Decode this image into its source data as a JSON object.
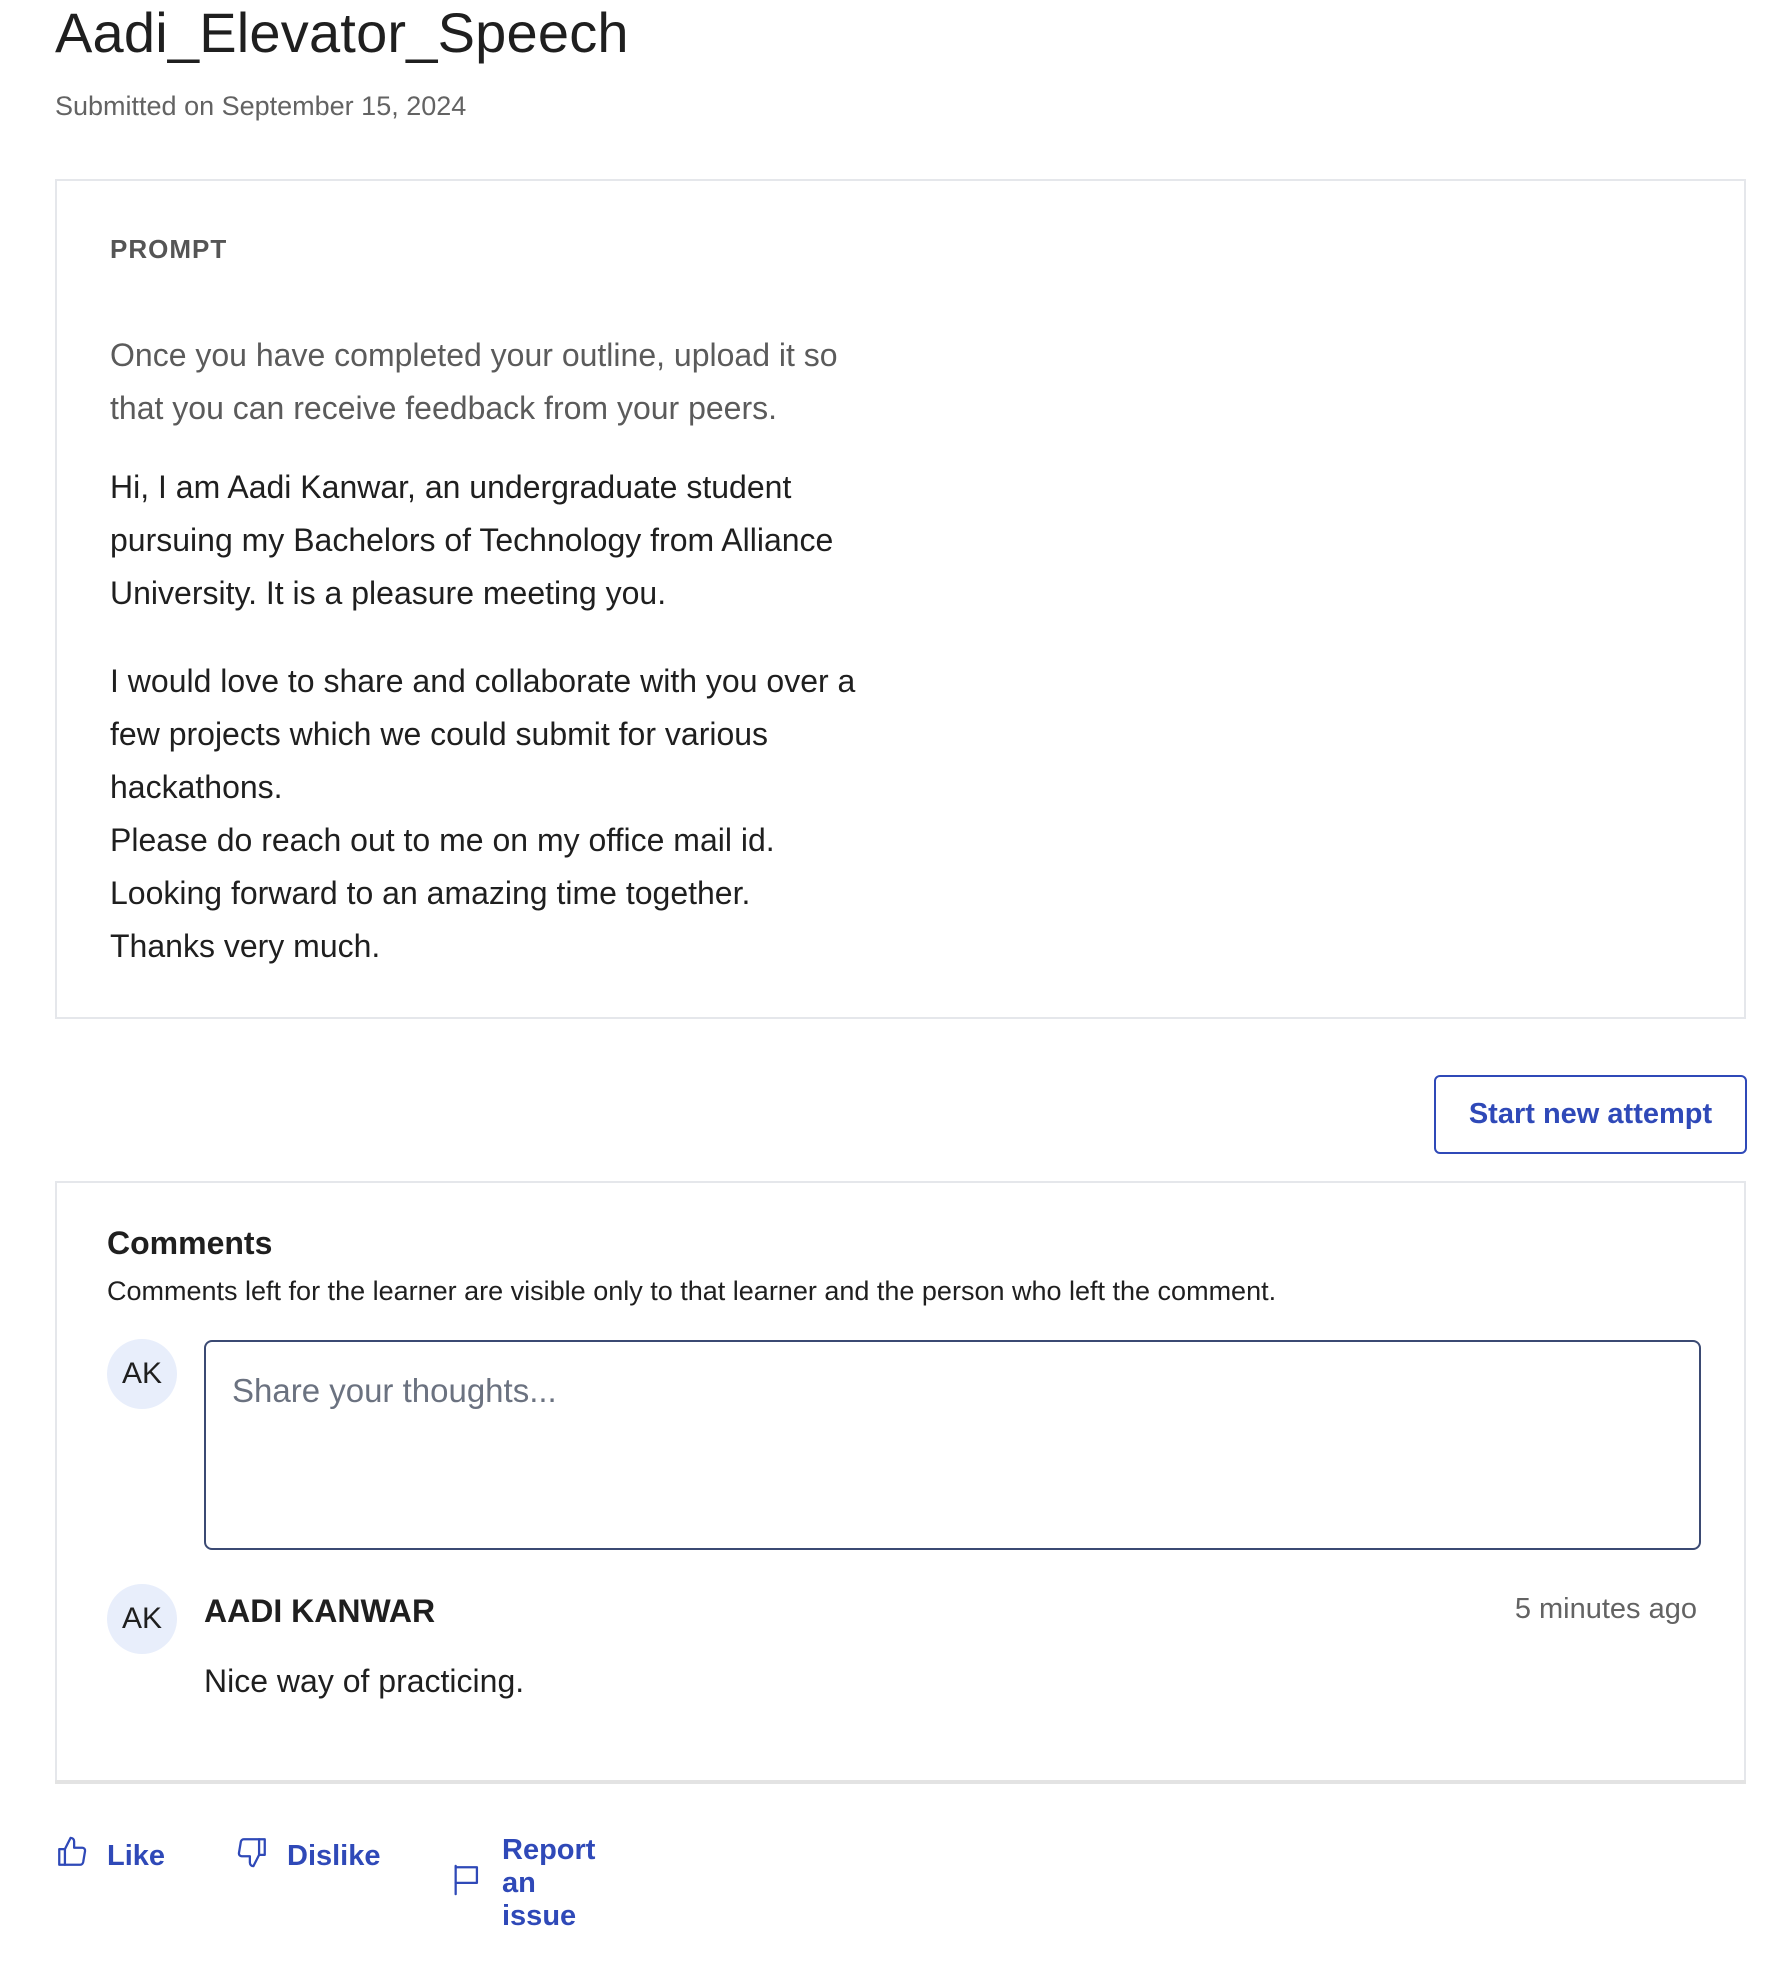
{
  "page": {
    "title": "Aadi_Elevator_Speech",
    "submitted": "Submitted on September 15, 2024"
  },
  "prompt": {
    "label": "PROMPT",
    "intro": "Once you have completed your outline, upload it so that you can receive feedback from your peers.",
    "paragraph1": "Hi, I am Aadi Kanwar, an undergraduate student pursuing my Bachelors of Technology from Alliance University.   It is a pleasure meeting you.",
    "paragraph2": "I would love to share and collaborate with you over a few projects which we could submit for various hackathons.\nPlease do reach out to me on my office mail id.\nLooking forward to an amazing time together.\nThanks very much."
  },
  "start_button": "Start new attempt",
  "comments": {
    "title": "Comments",
    "description": "Comments left for the learner are visible only to that learner and the person who left the comment.",
    "input_avatar": "AK",
    "input_placeholder": "Share your thoughts...",
    "items": [
      {
        "avatar": "AK",
        "author": "AADI KANWAR",
        "time": "5 minutes ago",
        "text": "Nice way of practicing."
      }
    ]
  },
  "actions": {
    "like": "Like",
    "dislike": "Dislike",
    "report": "Report an issue"
  },
  "colors": {
    "accent": "#2f49b8",
    "avatar_bg": "#e8eefb"
  }
}
